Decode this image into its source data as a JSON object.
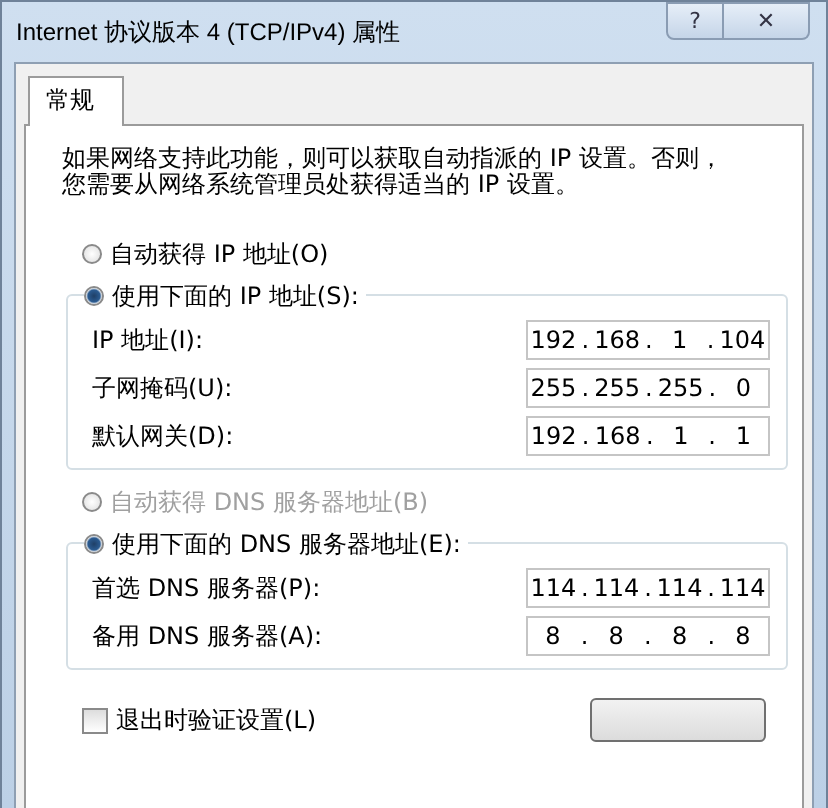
{
  "window": {
    "title": "Internet 协议版本 4 (TCP/IPv4) 属性",
    "buttons": [
      {
        "kind": "help",
        "label": "?"
      },
      {
        "kind": "close",
        "label": "✕"
      }
    ]
  },
  "tabs": [
    {
      "label": "常规",
      "selected": true
    }
  ],
  "description": "如果网络支持此功能，则可以获取自动指派的 IP 设置。否则，您需要从网络系统管理员处获得适当的 IP 设置。",
  "ip_section": {
    "auto_option": {
      "label": "自动获得 IP 地址(O)",
      "selected": false,
      "disabled": false
    },
    "manual_option": {
      "label": "使用下面的 IP 地址(S):",
      "selected": true,
      "disabled": false
    },
    "fields": [
      {
        "label": "IP 地址(I):",
        "octets": [
          "192",
          "168",
          "1",
          "104"
        ]
      },
      {
        "label": "子网掩码(U):",
        "octets": [
          "255",
          "255",
          "255",
          "0"
        ]
      },
      {
        "label": "默认网关(D):",
        "octets": [
          "192",
          "168",
          "1",
          "1"
        ]
      }
    ]
  },
  "dns_section": {
    "auto_option": {
      "label": "自动获得 DNS 服务器地址(B)",
      "selected": false,
      "disabled": true
    },
    "manual_option": {
      "label": "使用下面的 DNS 服务器地址(E):",
      "selected": true,
      "disabled": false
    },
    "fields": [
      {
        "label": "首选 DNS 服务器(P):",
        "octets": [
          "114",
          "114",
          "114",
          "114"
        ]
      },
      {
        "label": "备用 DNS 服务器(A):",
        "octets": [
          "8",
          "8",
          "8",
          "8"
        ]
      }
    ]
  },
  "octet_separator": ".",
  "validate_on_exit": {
    "label": "退出时验证设置(L)",
    "checked": false
  }
}
